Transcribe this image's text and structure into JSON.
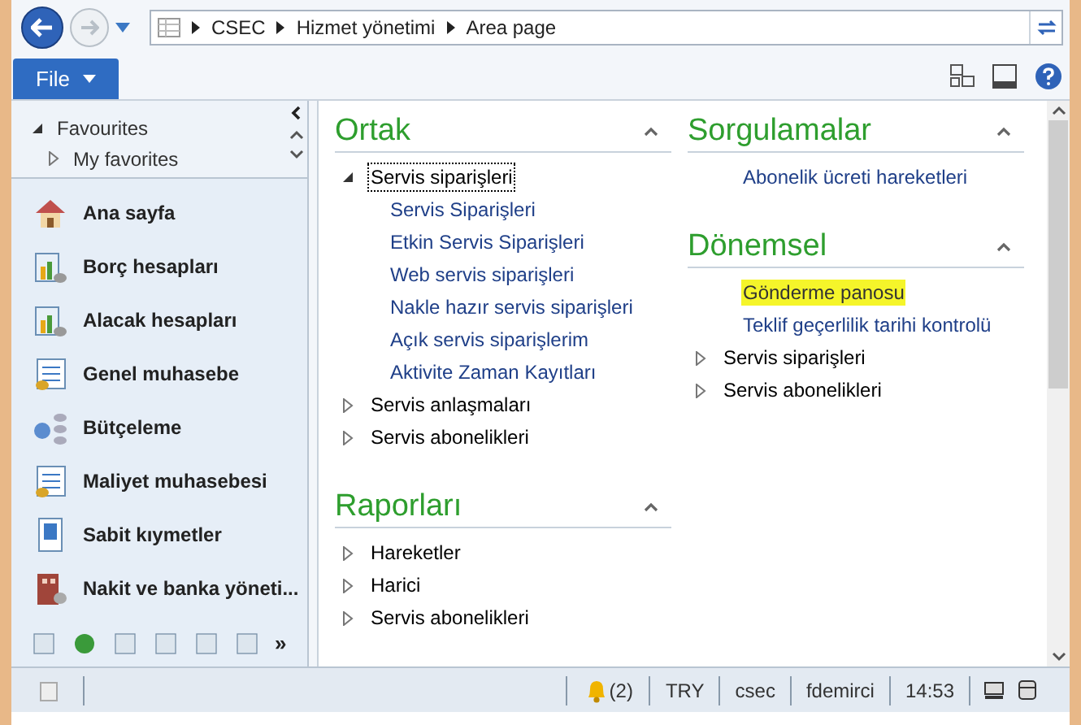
{
  "breadcrumb": [
    "CSEC",
    "Hizmet yönetimi",
    "Area page"
  ],
  "file_menu": "File",
  "favourites": [
    {
      "label": "Favourites",
      "expanded": true,
      "children": [
        {
          "label": "My favorites",
          "expanded": false
        }
      ]
    }
  ],
  "modules": [
    {
      "label": "Ana sayfa"
    },
    {
      "label": "Borç hesapları"
    },
    {
      "label": "Alacak hesapları"
    },
    {
      "label": "Genel muhasebe"
    },
    {
      "label": "Bütçeleme"
    },
    {
      "label": "Maliyet muhasebesi"
    },
    {
      "label": "Sabit kıymetler"
    },
    {
      "label": "Nakit ve banka yöneti..."
    }
  ],
  "overflow_glyph": "»",
  "columns": [
    [
      {
        "title": "Ortak",
        "items": [
          {
            "kind": "group",
            "label": "Servis siparişleri",
            "expanded": true,
            "focused": true,
            "children": [
              {
                "kind": "link",
                "label": "Servis Siparişleri",
                "highlighted": false
              },
              {
                "kind": "link",
                "label": "Etkin Servis Siparişleri",
                "highlighted": false
              },
              {
                "kind": "link",
                "label": "Web servis siparişleri",
                "highlighted": false
              },
              {
                "kind": "link",
                "label": "Nakle hazır servis siparişleri",
                "highlighted": false
              },
              {
                "kind": "link",
                "label": "Açık servis siparişlerim",
                "highlighted": false
              },
              {
                "kind": "link",
                "label": "Aktivite Zaman Kayıtları",
                "highlighted": false
              }
            ]
          },
          {
            "kind": "group",
            "label": "Servis anlaşmaları",
            "expanded": false,
            "focused": false
          },
          {
            "kind": "group",
            "label": "Servis abonelikleri",
            "expanded": false,
            "focused": false
          }
        ]
      },
      {
        "title": "Raporları",
        "items": [
          {
            "kind": "group",
            "label": "Hareketler",
            "expanded": false,
            "focused": false
          },
          {
            "kind": "group",
            "label": "Harici",
            "expanded": false,
            "focused": false
          },
          {
            "kind": "group",
            "label": "Servis abonelikleri",
            "expanded": false,
            "focused": false
          }
        ]
      }
    ],
    [
      {
        "title": "Sorgulamalar",
        "items": [
          {
            "kind": "link",
            "label": "Abonelik ücreti hareketleri",
            "highlighted": false
          }
        ]
      },
      {
        "title": "Dönemsel",
        "items": [
          {
            "kind": "link",
            "label": "Gönderme panosu",
            "highlighted": true
          },
          {
            "kind": "link",
            "label": "Teklif geçerlilik tarihi kontrolü",
            "highlighted": false
          },
          {
            "kind": "group",
            "label": "Servis siparişleri",
            "expanded": false,
            "focused": false
          },
          {
            "kind": "group",
            "label": "Servis abonelikleri",
            "expanded": false,
            "focused": false
          }
        ]
      }
    ]
  ],
  "status_bar": {
    "notifications": "(2)",
    "currency": "TRY",
    "company": "csec",
    "user": "fdemirci",
    "time": "14:53"
  }
}
